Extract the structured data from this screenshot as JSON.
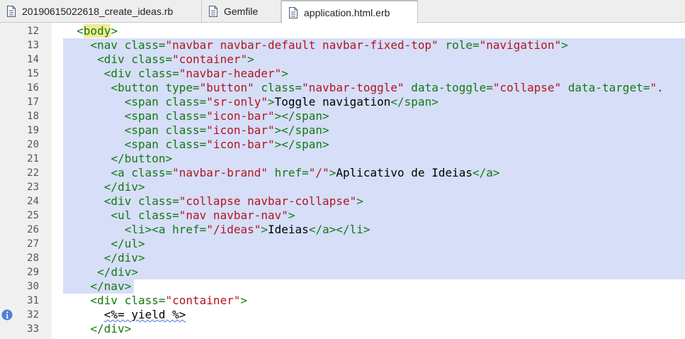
{
  "tabs": [
    {
      "label": "20190615022618_create_ideas.rb",
      "icon": "file-icon",
      "active": false
    },
    {
      "label": "Gemfile",
      "icon": "file-icon",
      "active": false
    },
    {
      "label": "application.html.erb",
      "icon": "file-icon",
      "active": true
    }
  ],
  "editor": {
    "selection_color": "#d6def8",
    "lines": [
      {
        "num": "12",
        "indent": "  ",
        "tokens": [
          [
            "tag",
            "<"
          ],
          [
            "hl",
            "body"
          ],
          [
            "tag",
            ">"
          ]
        ]
      },
      {
        "num": "13",
        "indent": "    ",
        "tokens": [
          [
            "tag",
            "<nav "
          ],
          [
            "attr",
            "class="
          ],
          [
            "str",
            "\"navbar navbar-default navbar-fixed-top\""
          ],
          [
            "attr",
            " role="
          ],
          [
            "str",
            "\"navigation\""
          ],
          [
            "tag",
            ">"
          ]
        ]
      },
      {
        "num": "14",
        "indent": "     ",
        "tokens": [
          [
            "tag",
            "<div "
          ],
          [
            "attr",
            "class="
          ],
          [
            "str",
            "\"container\""
          ],
          [
            "tag",
            ">"
          ]
        ]
      },
      {
        "num": "15",
        "indent": "      ",
        "tokens": [
          [
            "tag",
            "<div "
          ],
          [
            "attr",
            "class="
          ],
          [
            "str",
            "\"navbar-header\""
          ],
          [
            "tag",
            ">"
          ]
        ]
      },
      {
        "num": "16",
        "indent": "       ",
        "tokens": [
          [
            "tag",
            "<button "
          ],
          [
            "attr",
            "type="
          ],
          [
            "str",
            "\"button\""
          ],
          [
            "attr",
            " class="
          ],
          [
            "str",
            "\"navbar-toggle\""
          ],
          [
            "attr",
            " data-toggle="
          ],
          [
            "str",
            "\"collapse\""
          ],
          [
            "attr",
            " data-target="
          ],
          [
            "str",
            "\"."
          ]
        ]
      },
      {
        "num": "17",
        "indent": "         ",
        "tokens": [
          [
            "tag",
            "<span "
          ],
          [
            "attr",
            "class="
          ],
          [
            "str",
            "\"sr-only\""
          ],
          [
            "tag",
            ">"
          ],
          [
            "txt",
            "Toggle navigation"
          ],
          [
            "tag",
            "</span>"
          ]
        ]
      },
      {
        "num": "18",
        "indent": "         ",
        "tokens": [
          [
            "tag",
            "<span "
          ],
          [
            "attr",
            "class="
          ],
          [
            "str",
            "\"icon-bar\""
          ],
          [
            "tag",
            "></span>"
          ]
        ]
      },
      {
        "num": "19",
        "indent": "         ",
        "tokens": [
          [
            "tag",
            "<span "
          ],
          [
            "attr",
            "class="
          ],
          [
            "str",
            "\"icon-bar\""
          ],
          [
            "tag",
            "></span>"
          ]
        ]
      },
      {
        "num": "20",
        "indent": "         ",
        "tokens": [
          [
            "tag",
            "<span "
          ],
          [
            "attr",
            "class="
          ],
          [
            "str",
            "\"icon-bar\""
          ],
          [
            "tag",
            "></span>"
          ]
        ]
      },
      {
        "num": "21",
        "indent": "       ",
        "tokens": [
          [
            "tag",
            "</button>"
          ]
        ]
      },
      {
        "num": "22",
        "indent": "       ",
        "tokens": [
          [
            "tag",
            "<a "
          ],
          [
            "attr",
            "class="
          ],
          [
            "str",
            "\"navbar-brand\""
          ],
          [
            "attr",
            " href="
          ],
          [
            "str",
            "\"/\""
          ],
          [
            "tag",
            ">"
          ],
          [
            "txt",
            "Aplicativo de Ideias"
          ],
          [
            "tag",
            "</a>"
          ]
        ]
      },
      {
        "num": "23",
        "indent": "      ",
        "tokens": [
          [
            "tag",
            "</div>"
          ]
        ]
      },
      {
        "num": "24",
        "indent": "      ",
        "tokens": [
          [
            "tag",
            "<div "
          ],
          [
            "attr",
            "class="
          ],
          [
            "str",
            "\"collapse navbar-collapse\""
          ],
          [
            "tag",
            ">"
          ]
        ]
      },
      {
        "num": "25",
        "indent": "       ",
        "tokens": [
          [
            "tag",
            "<ul "
          ],
          [
            "attr",
            "class="
          ],
          [
            "str",
            "\"nav navbar-nav\""
          ],
          [
            "tag",
            ">"
          ]
        ]
      },
      {
        "num": "26",
        "indent": "         ",
        "tokens": [
          [
            "tag",
            "<li><a "
          ],
          [
            "attr",
            "href="
          ],
          [
            "str",
            "\"/ideas\""
          ],
          [
            "tag",
            ">"
          ],
          [
            "txt",
            "Ideias"
          ],
          [
            "tag",
            "</a></li>"
          ]
        ]
      },
      {
        "num": "27",
        "indent": "       ",
        "tokens": [
          [
            "tag",
            "</ul>"
          ]
        ]
      },
      {
        "num": "28",
        "indent": "      ",
        "tokens": [
          [
            "tag",
            "</div>"
          ]
        ]
      },
      {
        "num": "29",
        "indent": "     ",
        "tokens": [
          [
            "tag",
            "</div>"
          ]
        ]
      },
      {
        "num": "30",
        "indent": "    ",
        "tokens": [
          [
            "tag",
            "</nav>"
          ]
        ]
      },
      {
        "num": "31",
        "indent": "    ",
        "tokens": [
          [
            "tag",
            "<div "
          ],
          [
            "attr",
            "class="
          ],
          [
            "str",
            "\"container\""
          ],
          [
            "tag",
            ">"
          ]
        ]
      },
      {
        "num": "32",
        "indent": "      ",
        "tokens": [
          [
            "err",
            "<%= yield %>"
          ]
        ],
        "info": true
      },
      {
        "num": "33",
        "indent": "    ",
        "tokens": [
          [
            "tag",
            "</div>"
          ]
        ]
      }
    ]
  }
}
